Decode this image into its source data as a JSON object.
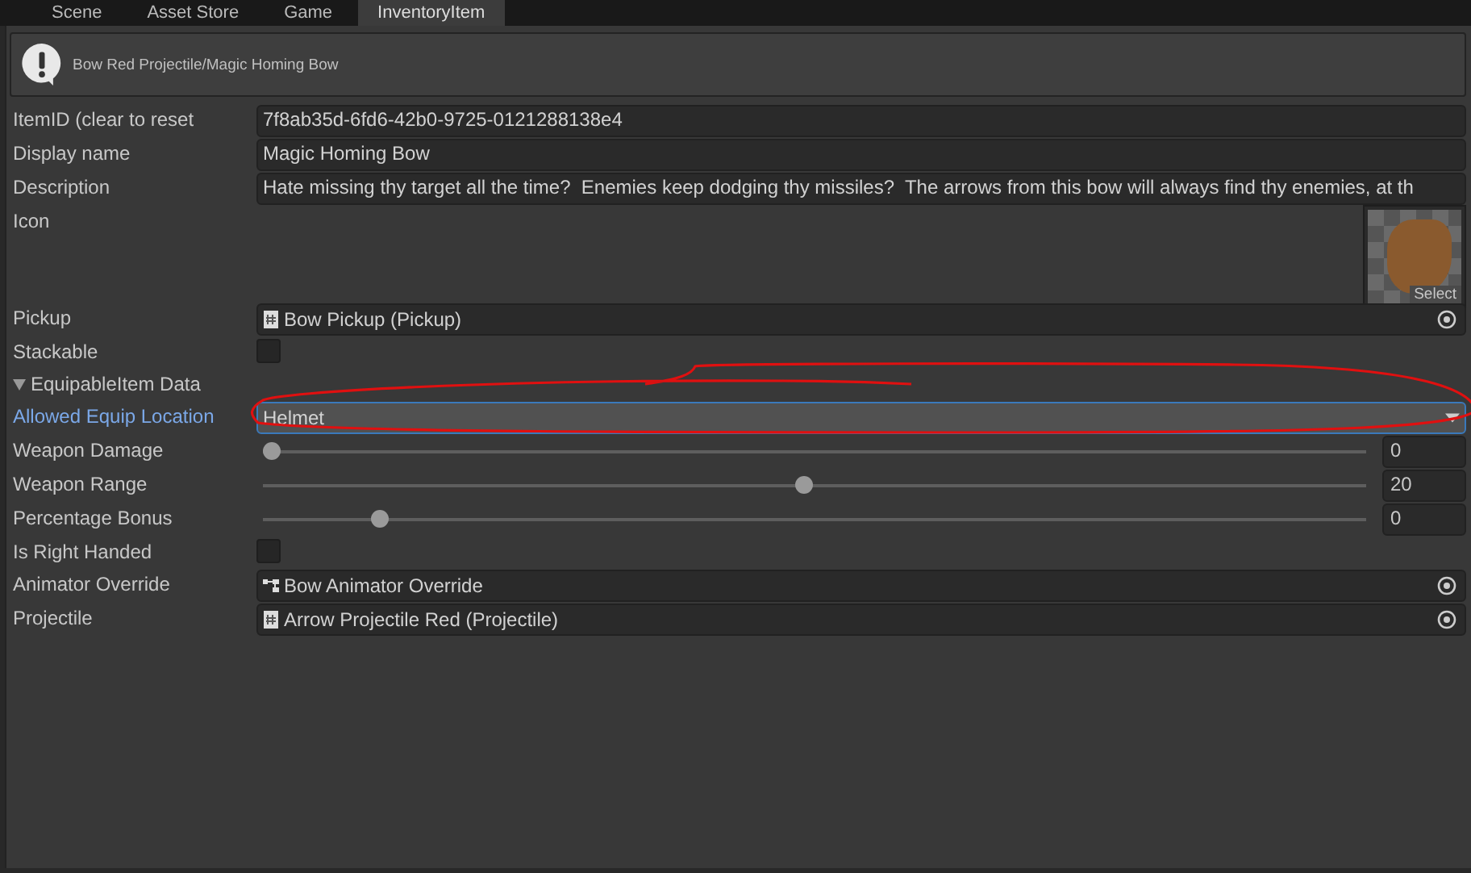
{
  "tabs": [
    {
      "label": "Scene",
      "selected": false
    },
    {
      "label": "Asset Store",
      "selected": false
    },
    {
      "label": "Game",
      "selected": false
    },
    {
      "label": "InventoryItem",
      "selected": true
    }
  ],
  "header": {
    "title": "Bow Red Projectile/Magic Homing Bow"
  },
  "fields": [
    {
      "kind": "text",
      "label": "ItemID (clear to reset",
      "value": "7f8ab35d-6fd6-42b0-9725-0121288138e4"
    },
    {
      "kind": "text",
      "label": "Display name",
      "value": "Magic Homing Bow"
    },
    {
      "kind": "text",
      "label": "Description",
      "value": "Hate missing thy target all the time?  Enemies keep dodging thy missiles?  The arrows from this bow will always find thy enemies, at th"
    },
    {
      "kind": "sprite",
      "label": "Icon",
      "button": "Select"
    },
    {
      "kind": "object",
      "label": "Pickup",
      "value": "Bow Pickup (Pickup)"
    },
    {
      "kind": "toggle",
      "label": "Stackable",
      "checked": false
    },
    {
      "kind": "foldout",
      "label": "EquipableItem Data",
      "expanded": true
    },
    {
      "kind": "dropdown",
      "label": "Allowed Equip Location",
      "value": "Helmet",
      "focused": true
    },
    {
      "kind": "slider",
      "label": "Weapon Damage",
      "level": 0,
      "value": "0"
    },
    {
      "kind": "slider",
      "label": "Weapon Range",
      "level": 0.49,
      "value": "20"
    },
    {
      "kind": "slider",
      "label": "Percentage Bonus",
      "level": 0.1,
      "value": "0"
    },
    {
      "kind": "toggle",
      "label": "Is Right Handed",
      "checked": false
    },
    {
      "kind": "object",
      "label": "Animator Override",
      "value": "Bow Animator Override"
    },
    {
      "kind": "object",
      "label": "Projectile",
      "value": "Arrow Projectile Red (Projectile)"
    }
  ],
  "markup": {
    "kind": "freehand-ellipse"
  }
}
